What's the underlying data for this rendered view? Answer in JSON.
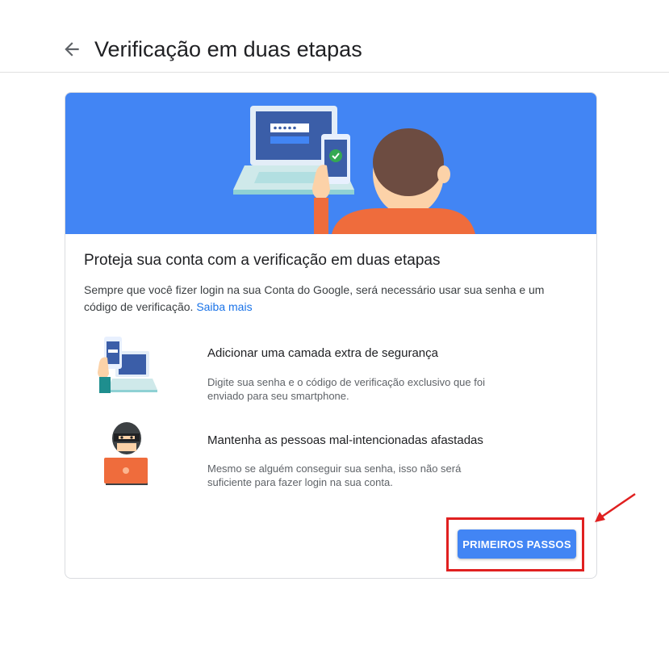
{
  "header": {
    "back_icon": "arrow-back-icon",
    "title": "Verificação em duas etapas"
  },
  "card": {
    "hero_color": "#4285f4",
    "title": "Proteja sua conta com a verificação em duas etapas",
    "description": "Sempre que você fizer login na sua Conta do Google, será necessário usar sua senha e um código de verificação.",
    "learn_more": "Saiba mais",
    "features": [
      {
        "icon": "phone-laptop-icon",
        "title": "Adicionar uma camada extra de segurança",
        "description": "Digite sua senha e o código de verificação exclusivo que foi enviado para seu smartphone."
      },
      {
        "icon": "hacker-icon",
        "title": "Mantenha as pessoas mal-intencionadas afastadas",
        "description": "Mesmo se alguém conseguir sua senha, isso não será suficiente para fazer login na sua conta."
      }
    ],
    "primary_button": "PRIMEIROS PASSOS"
  },
  "annotation": {
    "color": "#e02020"
  }
}
